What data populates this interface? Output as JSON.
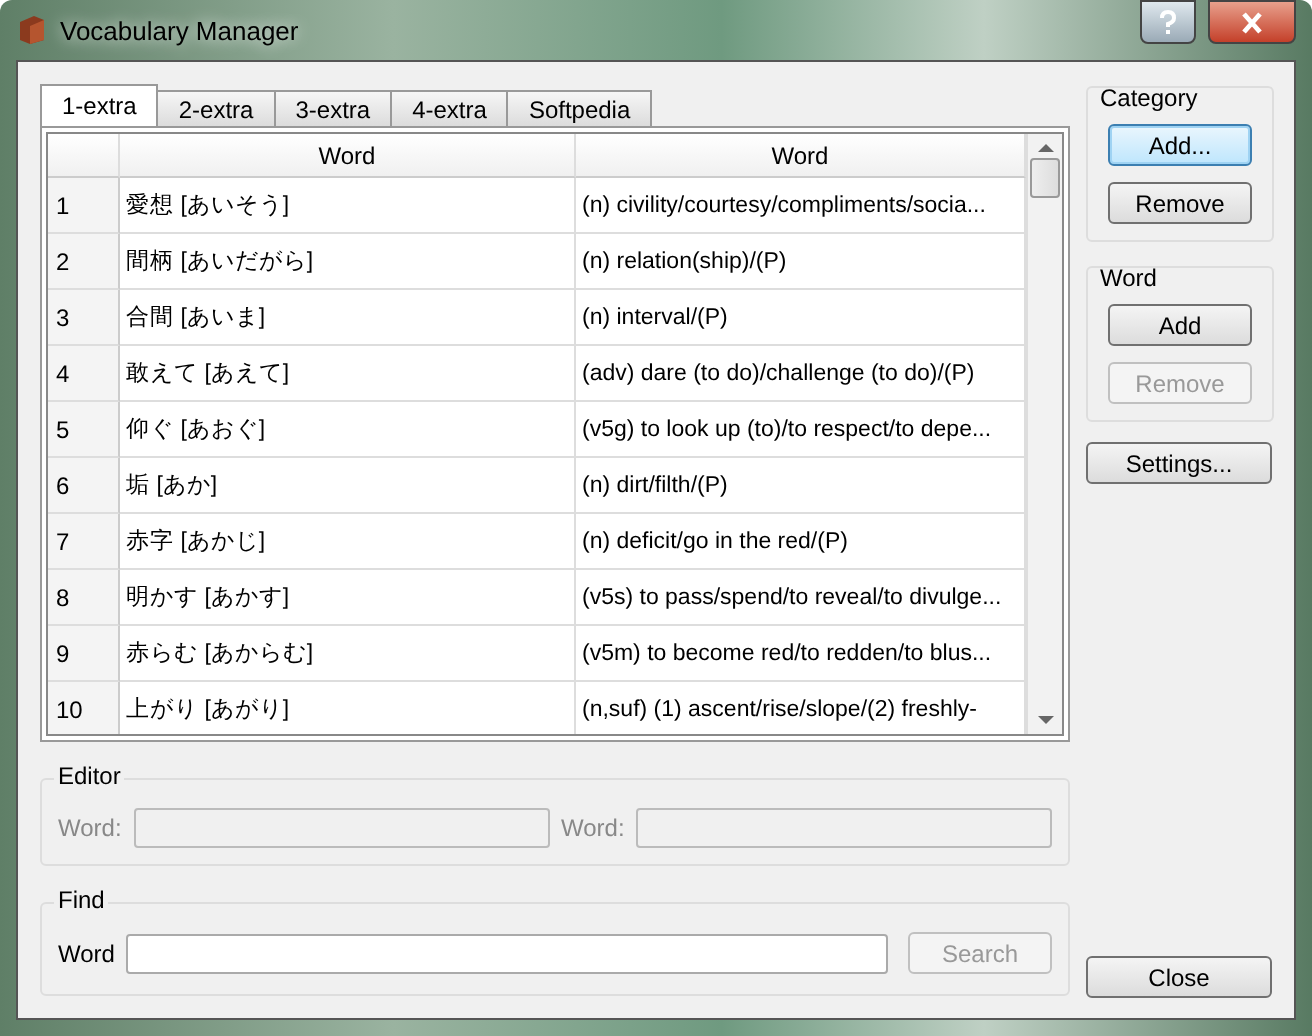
{
  "window": {
    "title": "Vocabulary Manager"
  },
  "tabs": [
    {
      "label": "1-extra",
      "selected": true
    },
    {
      "label": "2-extra",
      "selected": false
    },
    {
      "label": "3-extra",
      "selected": false
    },
    {
      "label": "4-extra",
      "selected": false
    },
    {
      "label": "Softpedia",
      "selected": false
    }
  ],
  "table": {
    "columns": [
      "Word",
      "Word"
    ],
    "rows": [
      {
        "number": "1",
        "word": "愛想 [あいそう]",
        "meaning": "(n) civility/courtesy/compliments/socia..."
      },
      {
        "number": "2",
        "word": "間柄 [あいだがら]",
        "meaning": "(n) relation(ship)/(P)"
      },
      {
        "number": "3",
        "word": "合間 [あいま]",
        "meaning": "(n) interval/(P)"
      },
      {
        "number": "4",
        "word": "敢えて [あえて]",
        "meaning": "(adv) dare (to do)/challenge (to do)/(P)"
      },
      {
        "number": "5",
        "word": "仰ぐ [あおぐ]",
        "meaning": "(v5g) to look up (to)/to respect/to depe..."
      },
      {
        "number": "6",
        "word": "垢 [あか]",
        "meaning": "(n) dirt/filth/(P)"
      },
      {
        "number": "7",
        "word": "赤字 [あかじ]",
        "meaning": "(n) deficit/go in the red/(P)"
      },
      {
        "number": "8",
        "word": "明かす [あかす]",
        "meaning": "(v5s) to pass/spend/to reveal/to divulge..."
      },
      {
        "number": "9",
        "word": "赤らむ [あからむ]",
        "meaning": "(v5m) to become red/to redden/to blus..."
      },
      {
        "number": "10",
        "word": "上がり [あがり]",
        "meaning": "(n,suf) (1) ascent/rise/slope/(2) freshly-"
      }
    ]
  },
  "editor": {
    "title": "Editor",
    "disabled": true,
    "fields": [
      {
        "label": "Word:"
      },
      {
        "label": "Word:"
      }
    ]
  },
  "find": {
    "title": "Find",
    "label": "Word",
    "button": {
      "label": "Search",
      "disabled": true
    }
  },
  "category": {
    "title": "Category",
    "buttons": [
      {
        "label": "Add...",
        "disabled": false,
        "focused": true
      },
      {
        "label": "Remove",
        "disabled": false,
        "focused": false
      }
    ]
  },
  "word": {
    "title": "Word",
    "buttons": [
      {
        "label": "Add",
        "disabled": false,
        "focused": false
      },
      {
        "label": "Remove",
        "disabled": true,
        "focused": false
      }
    ]
  },
  "settings_button": {
    "label": "Settings...",
    "disabled": false,
    "focused": false
  },
  "close_button": {
    "label": "Close",
    "disabled": false,
    "focused": false
  }
}
